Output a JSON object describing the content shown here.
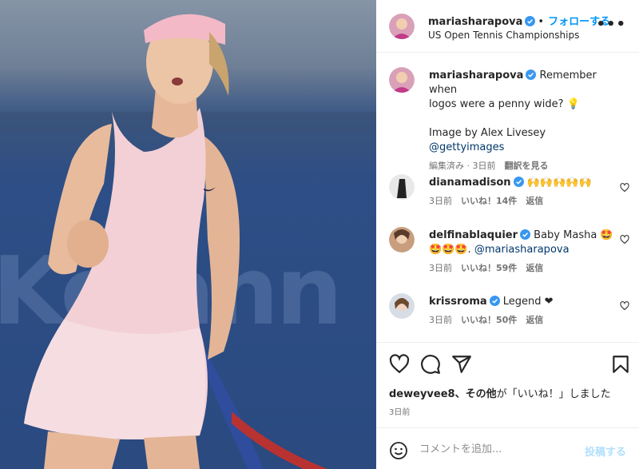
{
  "post": {
    "image_alt": "Maria Sharapova in pink tennis dress clenching fist",
    "wall_text": "Ko ann"
  },
  "header": {
    "username": "mariasharapova",
    "separator": "•",
    "follow_label": "フォローする",
    "location": "US Open Tennis Championships",
    "more_icon": "more-horizontal-icon"
  },
  "caption": {
    "username": "mariasharapova",
    "text_line1": "Remember when",
    "text_line2": "logos were a penny wide? 💡",
    "credit_line1": "Image by Alex Livesey",
    "credit_line2": "@gettyimages",
    "meta_edited": "編集済み · 3日前",
    "meta_translate": "翻訳を見る"
  },
  "comments": [
    {
      "username": "dianamadison",
      "text": "🙌🙌🙌🙌🙌",
      "time": "3日前",
      "likes": "いいね！14件",
      "reply": "返信"
    },
    {
      "username": "delfinablaquier",
      "text": "Baby Masha 🤩",
      "text2": "🤩🤩🤩.",
      "mention": "@mariasharapova",
      "time": "3日前",
      "likes": "いいね！59件",
      "reply": "返信"
    },
    {
      "username": "krissroma",
      "text": "Legend ❤",
      "time": "3日前",
      "likes": "いいね！50件",
      "reply": "返信"
    }
  ],
  "liked_by": {
    "user": "deweyvee8",
    "suffix_bold": "、その他",
    "suffix": "が「いいね！」しました"
  },
  "date": "3日前",
  "add_comment": {
    "placeholder": "コメントを追加...",
    "post_label": "投稿する"
  },
  "colors": {
    "accent": "#0095f6",
    "verified": "#3897f0",
    "post_disabled": "#b2dffc"
  }
}
